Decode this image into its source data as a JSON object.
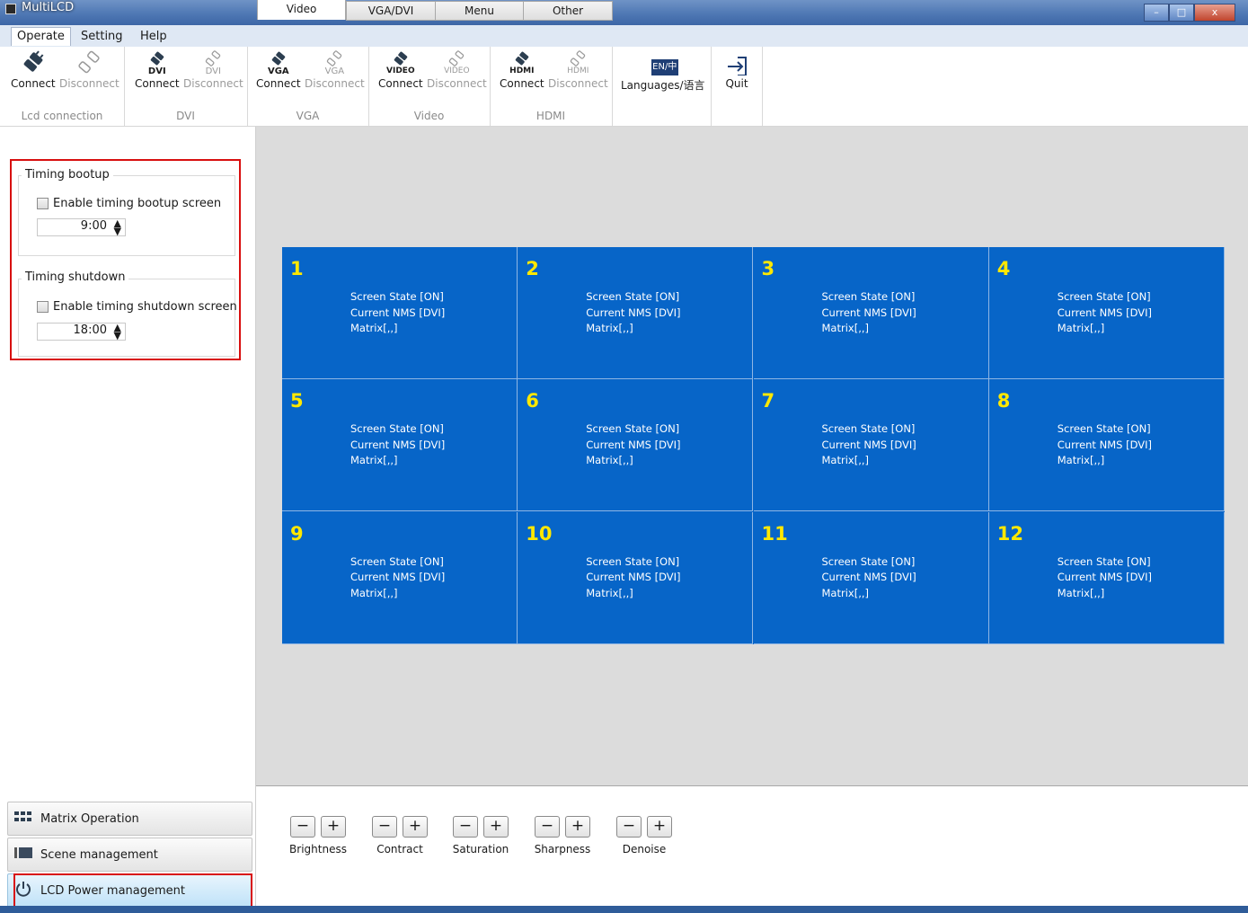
{
  "window": {
    "title": "MultiLCD",
    "minimize": "–",
    "maximize": "□",
    "close": "x"
  },
  "menu": [
    "Operate",
    "Setting",
    "Help"
  ],
  "ribbon": {
    "lcd": {
      "connect": "Connect",
      "disconnect": "Disconnect",
      "group": "Lcd connection"
    },
    "dvi": {
      "sub": "DVI",
      "connect": "Connect",
      "disconnect": "Disconnect",
      "group": "DVI"
    },
    "vga": {
      "sub": "VGA",
      "connect": "Connect",
      "disconnect": "Disconnect",
      "group": "VGA"
    },
    "video": {
      "sub": "VIDEO",
      "connect": "Connect",
      "disconnect": "Disconnect",
      "group": "Video"
    },
    "hdmi": {
      "sub": "HDMI",
      "connect": "Connect",
      "disconnect": "Disconnect",
      "group": "HDMI"
    },
    "languages": {
      "icon_text": "EN/中",
      "label": "Languages/语言"
    },
    "quit": {
      "label": "Quit"
    }
  },
  "timing": {
    "bootup": {
      "legend": "Timing bootup",
      "checkbox": "Enable timing bootup screen",
      "time": "9:00"
    },
    "shutdown": {
      "legend": "Timing shutdown",
      "checkbox": "Enable timing shutdown screen",
      "time": "18:00"
    }
  },
  "nav": {
    "matrix": "Matrix Operation",
    "scene": "Scene management",
    "power": "LCD Power management"
  },
  "screens": [
    {
      "num": "1",
      "state": "Screen State [ON]",
      "nms": "Current NMS [DVI]",
      "matrix": "Matrix[,,]"
    },
    {
      "num": "2",
      "state": "Screen State [ON]",
      "nms": "Current NMS [DVI]",
      "matrix": "Matrix[,,]"
    },
    {
      "num": "3",
      "state": "Screen State [ON]",
      "nms": "Current NMS [DVI]",
      "matrix": "Matrix[,,]"
    },
    {
      "num": "4",
      "state": "Screen State [ON]",
      "nms": "Current NMS [DVI]",
      "matrix": "Matrix[,,]"
    },
    {
      "num": "5",
      "state": "Screen State [ON]",
      "nms": "Current NMS [DVI]",
      "matrix": "Matrix[,,]"
    },
    {
      "num": "6",
      "state": "Screen State [ON]",
      "nms": "Current NMS [DVI]",
      "matrix": "Matrix[,,]"
    },
    {
      "num": "7",
      "state": "Screen State [ON]",
      "nms": "Current NMS [DVI]",
      "matrix": "Matrix[,,]"
    },
    {
      "num": "8",
      "state": "Screen State [ON]",
      "nms": "Current NMS [DVI]",
      "matrix": "Matrix[,,]"
    },
    {
      "num": "9",
      "state": "Screen State [ON]",
      "nms": "Current NMS [DVI]",
      "matrix": "Matrix[,,]"
    },
    {
      "num": "10",
      "state": "Screen State [ON]",
      "nms": "Current NMS [DVI]",
      "matrix": "Matrix[,,]"
    },
    {
      "num": "11",
      "state": "Screen State [ON]",
      "nms": "Current NMS [DVI]",
      "matrix": "Matrix[,,]"
    },
    {
      "num": "12",
      "state": "Screen State [ON]",
      "nms": "Current NMS [DVI]",
      "matrix": "Matrix[,,]"
    }
  ],
  "tabs": [
    "Video",
    "VGA/DVI",
    "Menu",
    "Other"
  ],
  "adjust": {
    "minus": "−",
    "plus": "+",
    "labels": [
      "Brightness",
      "Contract",
      "Saturation",
      "Sharpness",
      "Denoise"
    ]
  },
  "colors": {
    "grid_bg": "#0765c8",
    "screen_number": "#ffe800",
    "highlight_box": "#d80f0f"
  }
}
